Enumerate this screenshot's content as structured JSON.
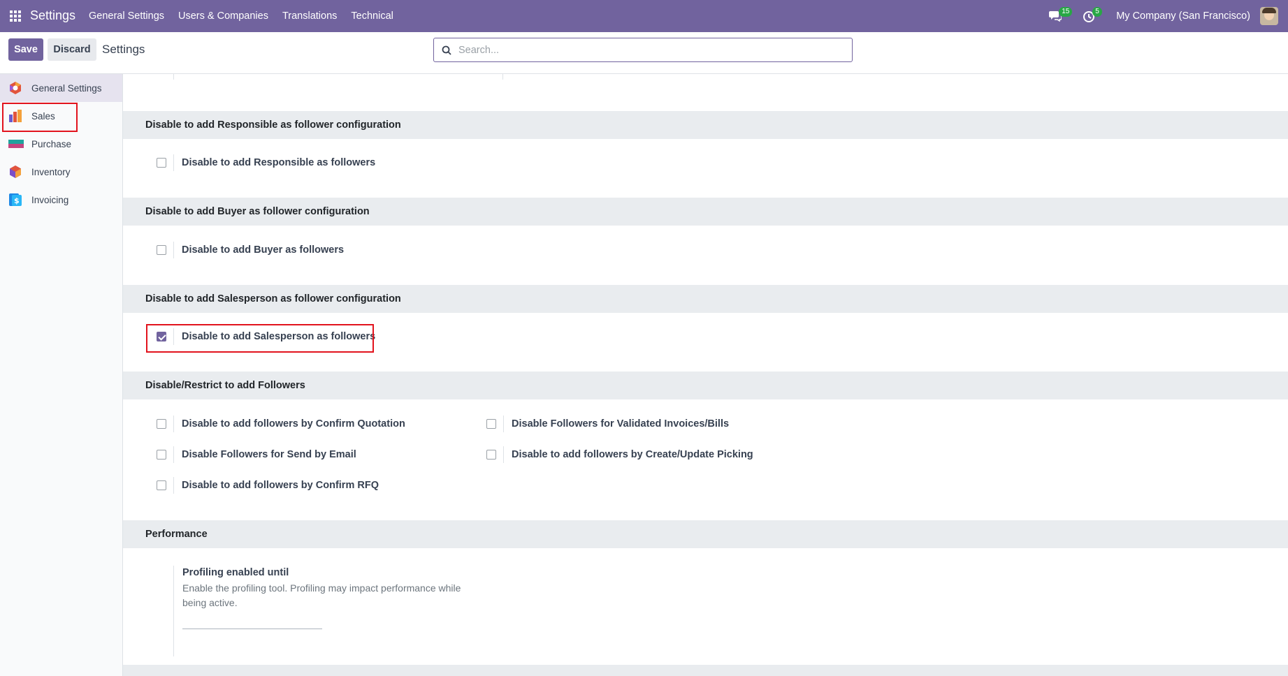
{
  "navbar": {
    "brand": "Settings",
    "menu": [
      "General Settings",
      "Users & Companies",
      "Translations",
      "Technical"
    ],
    "messages_badge": "15",
    "activities_badge": "5",
    "company": "My Company (San Francisco)"
  },
  "control": {
    "save_label": "Save",
    "discard_label": "Discard",
    "breadcrumb": "Settings",
    "search_placeholder": "Search..."
  },
  "sidebar": {
    "items": [
      {
        "label": "General Settings",
        "icon": "general-settings-icon",
        "active": true
      },
      {
        "label": "Sales",
        "icon": "sales-icon"
      },
      {
        "label": "Purchase",
        "icon": "purchase-icon"
      },
      {
        "label": "Inventory",
        "icon": "inventory-icon"
      },
      {
        "label": "Invoicing",
        "icon": "invoicing-icon"
      }
    ]
  },
  "sections": [
    {
      "title": "Disable to add Responsible as follower configuration",
      "settings": [
        {
          "label": "Disable to add Responsible as followers",
          "checked": false
        }
      ]
    },
    {
      "title": "Disable to add Buyer as follower configuration",
      "settings": [
        {
          "label": "Disable to add Buyer as followers",
          "checked": false
        }
      ]
    },
    {
      "title": "Disable to add Salesperson as follower configuration",
      "settings": [
        {
          "label": "Disable to add Salesperson as followers",
          "checked": true
        }
      ]
    },
    {
      "title": "Disable/Restrict to add Followers",
      "settings": [
        {
          "label": "Disable to add followers by Confirm Quotation",
          "checked": false
        },
        {
          "label": "Disable Followers for Validated Invoices/Bills",
          "checked": false
        },
        {
          "label": "Disable Followers for Send by Email",
          "checked": false
        },
        {
          "label": "Disable to add followers by Create/Update Picking",
          "checked": false
        },
        {
          "label": "Disable to add followers by Confirm RFQ",
          "checked": false
        }
      ]
    },
    {
      "title": "Performance",
      "settings": [
        {
          "label": "Profiling enabled until",
          "description": "Enable the profiling tool. Profiling may impact performance while being active."
        }
      ]
    }
  ],
  "colors": {
    "brand": "#71639e",
    "highlight": "#e2131d",
    "badge": "#28a745"
  }
}
